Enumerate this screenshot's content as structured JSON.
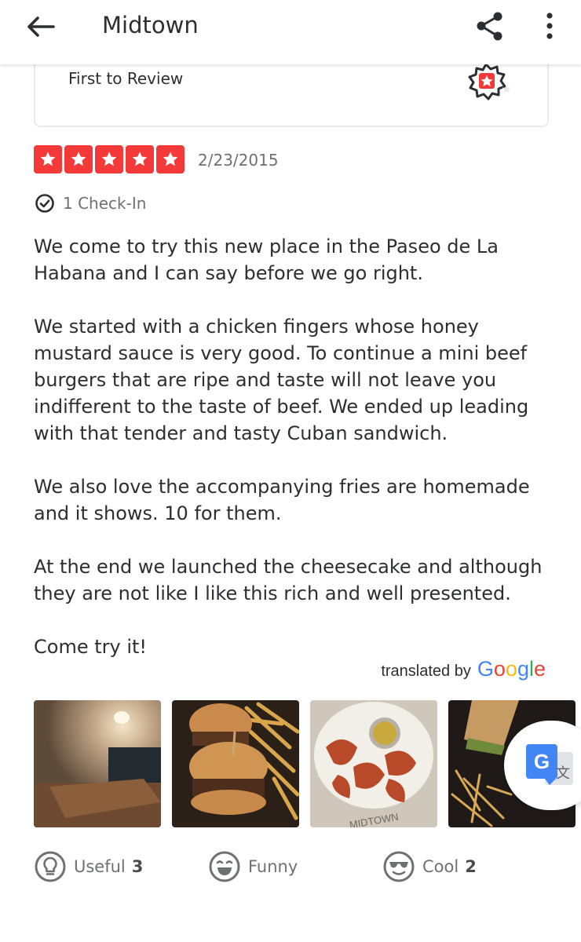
{
  "header": {
    "title": "Midtown",
    "back_icon": "arrow-left-icon",
    "share_icon": "share-icon",
    "more_icon": "more-vertical-icon"
  },
  "badge": {
    "label": "First to Review",
    "icon": "first-to-review-badge-icon"
  },
  "review": {
    "rating": 5,
    "date": "2/23/2015",
    "checkin_text": "1 Check-In",
    "paragraphs": [
      "We come to try this new place in the Paseo de La Habana and I can say before we go right.",
      "We started with a chicken fingers whose honey mustard sauce is very good. To continue a mini beef burgers that are ripe and taste will not leave you indifferent to the taste of beef. We ended up leading with that tender and tasty Cuban sandwich.",
      "We also love the accompanying fries are homemade and it shows. 10 for them.",
      "At the end we launched the cheesecake and although they are not like I like this rich and well presented.",
      "Come try it!"
    ],
    "translated_by": "translated by",
    "translator": "Google"
  },
  "photos": [
    {
      "subject": "restaurant-interior-photo"
    },
    {
      "subject": "mini-burgers-photo"
    },
    {
      "subject": "chicken-fingers-photo",
      "plate_text": "MIDTOWN"
    },
    {
      "subject": "cuban-sandwich-photo"
    }
  ],
  "actions": {
    "useful": {
      "label": "Useful",
      "count": "3"
    },
    "funny": {
      "label": "Funny",
      "count": ""
    },
    "cool": {
      "label": "Cool",
      "count": "2"
    }
  },
  "colors": {
    "accent_red": "#f43939",
    "text": "#2d2e33",
    "muted": "#6e7072"
  }
}
